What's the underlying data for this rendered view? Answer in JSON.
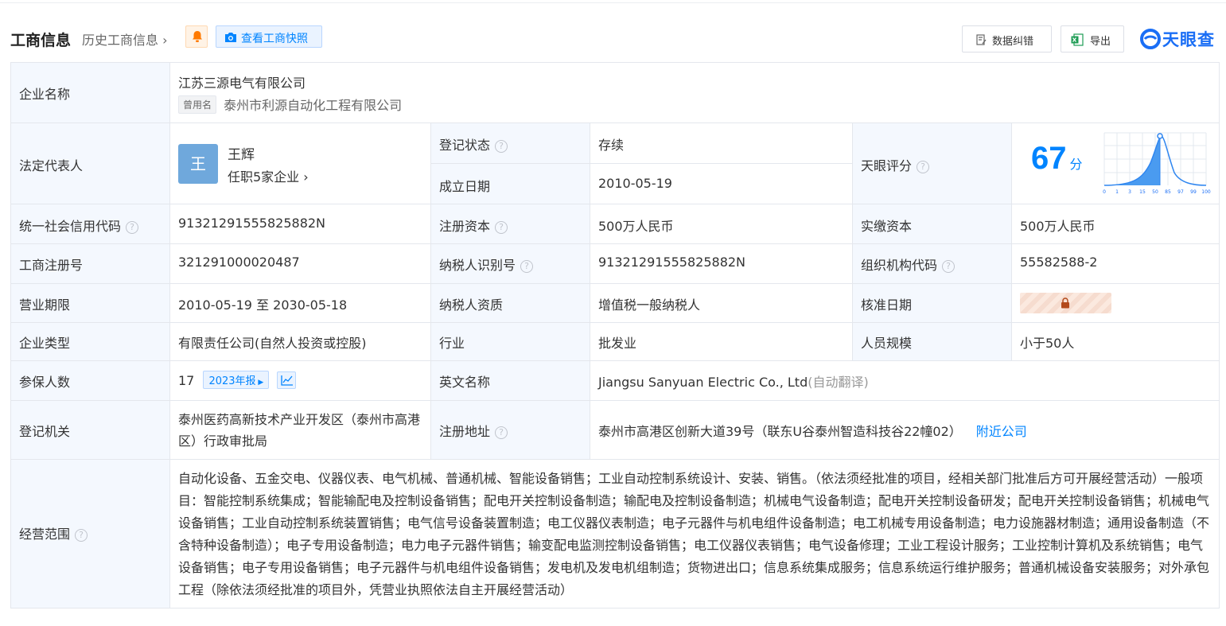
{
  "header": {
    "title": "工商信息",
    "history_link": "历史工商信息",
    "snapshot_btn": "查看工商快照",
    "correct_btn": "数据纠错",
    "export_btn": "导出",
    "brand": "天眼查"
  },
  "company": {
    "name_label": "企业名称",
    "name": "江苏三源电气有限公司",
    "former_tag": "曾用名",
    "former_name": "泰州市利源自动化工程有限公司",
    "legal_label": "法定代表人",
    "legal_avatar": "王",
    "legal_name": "王辉",
    "legal_roles": "任职5家企业",
    "status_label": "登记状态",
    "status": "存续",
    "found_label": "成立日期",
    "found_date": "2010-05-19",
    "score_label": "天眼评分",
    "score": "67",
    "score_unit": "分",
    "score_ticks": [
      "0",
      "1",
      "3",
      "15",
      "50",
      "85",
      "97",
      "99",
      "100"
    ],
    "credit_label": "统一社会信用代码",
    "credit_code": "91321291555825882N",
    "reg_cap_label": "注册资本",
    "reg_cap": "500万人民币",
    "paid_cap_label": "实缴资本",
    "paid_cap": "500万人民币",
    "reg_no_label": "工商注册号",
    "reg_no": "321291000020487",
    "tax_id_label": "纳税人识别号",
    "tax_id": "91321291555825882N",
    "org_code_label": "组织机构代码",
    "org_code": "55582588-2",
    "term_label": "营业期限",
    "term": "2010-05-19 至 2030-05-18",
    "tax_qual_label": "纳税人资质",
    "tax_qual": "增值税一般纳税人",
    "approve_label": "核准日期",
    "type_label": "企业类型",
    "type": "有限责任公司(自然人投资或控股)",
    "industry_label": "行业",
    "industry": "批发业",
    "staff_label": "人员规模",
    "staff": "小于50人",
    "insured_label": "参保人数",
    "insured": "17",
    "insured_year": "2023年报",
    "en_name_label": "英文名称",
    "en_name": "Jiangsu Sanyuan Electric Co., Ltd",
    "en_auto": "(自动翻译)",
    "authority_label": "登记机关",
    "authority": "泰州医药高新技术产业开发区（泰州市高港区）行政审批局",
    "address_label": "注册地址",
    "address": "泰州市高港区创新大道39号（联东U谷泰州智造科技谷22幢02）",
    "nearby": "附近公司",
    "scope_label": "经营范围",
    "scope": "自动化设备、五金交电、仪器仪表、电气机械、普通机械、智能设备销售；工业自动控制系统设计、安装、销售。（依法须经批准的项目，经相关部门批准后方可开展经营活动）一般项目：智能控制系统集成；智能输配电及控制设备销售；配电开关控制设备制造；输配电及控制设备制造；机械电气设备制造；配电开关控制设备研发；配电开关控制设备销售；机械电气设备销售；工业自动控制系统装置销售；电气信号设备装置制造；电工仪器仪表制造；电子元器件与机电组件设备制造；电工机械专用设备制造；电力设施器材制造；通用设备制造（不含特种设备制造）；电子专用设备制造；电力电子元器件销售；输变配电监测控制设备销售；电工仪器仪表销售；电气设备修理；工业工程设计服务；工业控制计算机及系统销售；电气设备销售；电子专用设备销售；电子元器件与机电组件设备销售；发电机及发电机组制造；货物进出口；信息系统集成服务；信息系统运行维护服务；普通机械设备安装服务；对外承包工程（除依法须经批准的项目外，凭营业执照依法自主开展经营活动）"
  }
}
